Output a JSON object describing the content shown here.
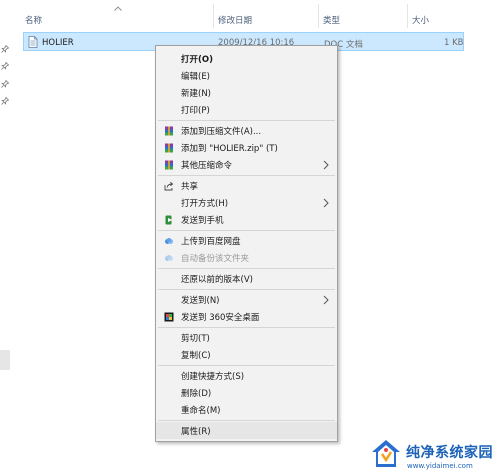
{
  "columns": {
    "name": "名称",
    "modified": "修改日期",
    "type": "类型",
    "size": "大小"
  },
  "file": {
    "name": "HOLIER",
    "modified": "2009/12/16 10:16",
    "type": "DOC 文档",
    "size": "1 KB"
  },
  "menu": {
    "open": "打开(O)",
    "edit": "编辑(E)",
    "new": "新建(N)",
    "print": "打印(P)",
    "add_archive": "添加到压缩文件(A)...",
    "add_zip": "添加到 \"HOLIER.zip\" (T)",
    "other_compress": "其他压缩命令",
    "share": "共享",
    "open_with": "打开方式(H)",
    "send_phone": "发送到手机",
    "upload_baidu": "上传到百度网盘",
    "auto_backup": "自动备份该文件夹",
    "restore": "还原以前的版本(V)",
    "send_to": "发送到(N)",
    "send_360": "发送到 360安全桌面",
    "cut": "剪切(T)",
    "copy": "复制(C)",
    "create_shortcut": "创建快捷方式(S)",
    "delete": "删除(D)",
    "rename": "重命名(M)",
    "properties": "属性(R)"
  },
  "watermark": {
    "title": "纯净系统家园",
    "url": "www.yidaimei.com"
  }
}
